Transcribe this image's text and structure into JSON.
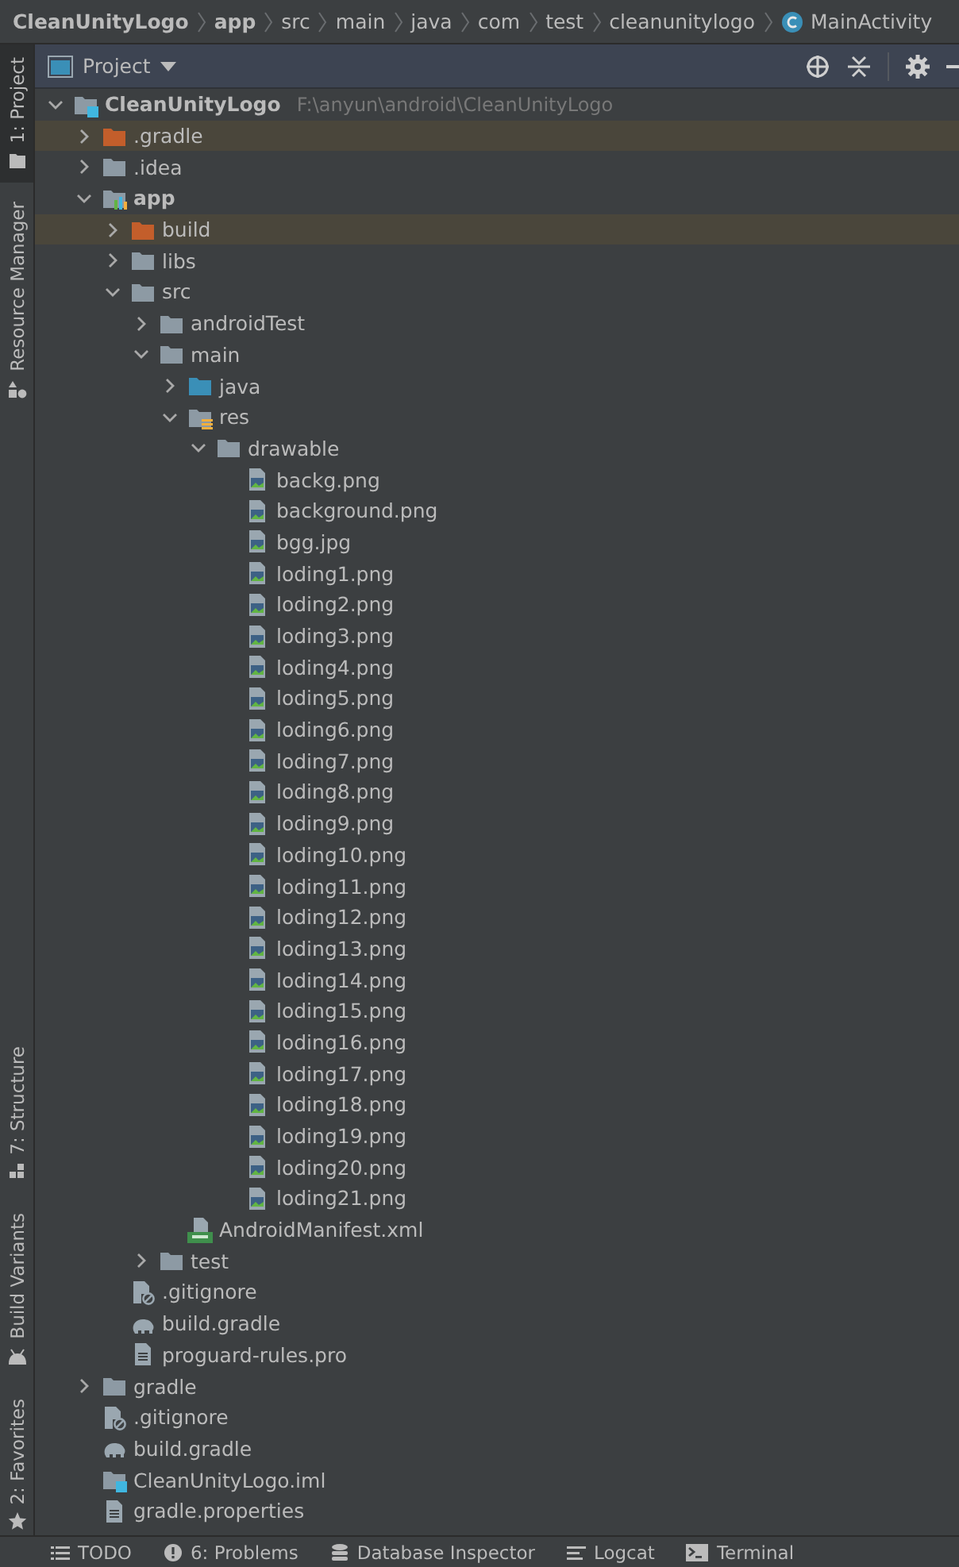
{
  "breadcrumbs": [
    {
      "label": "CleanUnityLogo",
      "kind": "module"
    },
    {
      "label": "app",
      "kind": "module"
    },
    {
      "label": "src",
      "kind": "folder"
    },
    {
      "label": "main",
      "kind": "folder"
    },
    {
      "label": "java",
      "kind": "folder"
    },
    {
      "label": "com",
      "kind": "folder"
    },
    {
      "label": "test",
      "kind": "folder"
    },
    {
      "label": "cleanunitylogo",
      "kind": "folder"
    },
    {
      "label": "MainActivity",
      "kind": "class"
    }
  ],
  "side_tabs": [
    {
      "label": "1: Project",
      "kind": "project",
      "selected": true
    },
    {
      "label": "Resource Manager",
      "kind": "resources",
      "selected": false
    },
    {
      "label": "7: Structure",
      "kind": "structure",
      "selected": false
    },
    {
      "label": "Build Variants",
      "kind": "variants",
      "selected": false
    },
    {
      "label": "2: Favorites",
      "kind": "favorites",
      "selected": false
    }
  ],
  "panel": {
    "title": "Project"
  },
  "tree": [
    {
      "label": "CleanUnityLogo",
      "kind": "project",
      "hint": "F:\\anyun\\android\\CleanUnityLogo",
      "expanded": true,
      "children": [
        {
          "label": ".gradle",
          "kind": "excluded-folder",
          "expanded": false
        },
        {
          "label": ".idea",
          "kind": "folder",
          "expanded": false
        },
        {
          "label": "app",
          "kind": "module",
          "expanded": true,
          "children": [
            {
              "label": "build",
              "kind": "excluded-folder",
              "expanded": false
            },
            {
              "label": "libs",
              "kind": "folder",
              "expanded": false
            },
            {
              "label": "src",
              "kind": "folder",
              "expanded": true,
              "children": [
                {
                  "label": "androidTest",
                  "kind": "folder",
                  "expanded": false
                },
                {
                  "label": "main",
                  "kind": "folder",
                  "expanded": true,
                  "children": [
                    {
                      "label": "java",
                      "kind": "source-folder",
                      "expanded": false
                    },
                    {
                      "label": "res",
                      "kind": "resource-folder",
                      "expanded": true,
                      "children": [
                        {
                          "label": "drawable",
                          "kind": "folder",
                          "expanded": true,
                          "children": [
                            {
                              "label": "backg.png",
                              "kind": "image-file"
                            },
                            {
                              "label": "background.png",
                              "kind": "image-file"
                            },
                            {
                              "label": "bgg.jpg",
                              "kind": "image-file"
                            },
                            {
                              "label": "loding1.png",
                              "kind": "image-file"
                            },
                            {
                              "label": "loding2.png",
                              "kind": "image-file"
                            },
                            {
                              "label": "loding3.png",
                              "kind": "image-file"
                            },
                            {
                              "label": "loding4.png",
                              "kind": "image-file"
                            },
                            {
                              "label": "loding5.png",
                              "kind": "image-file"
                            },
                            {
                              "label": "loding6.png",
                              "kind": "image-file"
                            },
                            {
                              "label": "loding7.png",
                              "kind": "image-file"
                            },
                            {
                              "label": "loding8.png",
                              "kind": "image-file"
                            },
                            {
                              "label": "loding9.png",
                              "kind": "image-file"
                            },
                            {
                              "label": "loding10.png",
                              "kind": "image-file"
                            },
                            {
                              "label": "loding11.png",
                              "kind": "image-file"
                            },
                            {
                              "label": "loding12.png",
                              "kind": "image-file"
                            },
                            {
                              "label": "loding13.png",
                              "kind": "image-file"
                            },
                            {
                              "label": "loding14.png",
                              "kind": "image-file"
                            },
                            {
                              "label": "loding15.png",
                              "kind": "image-file"
                            },
                            {
                              "label": "loding16.png",
                              "kind": "image-file"
                            },
                            {
                              "label": "loding17.png",
                              "kind": "image-file"
                            },
                            {
                              "label": "loding18.png",
                              "kind": "image-file"
                            },
                            {
                              "label": "loding19.png",
                              "kind": "image-file"
                            },
                            {
                              "label": "loding20.png",
                              "kind": "image-file"
                            },
                            {
                              "label": "loding21.png",
                              "kind": "image-file"
                            }
                          ]
                        }
                      ]
                    },
                    {
                      "label": "AndroidManifest.xml",
                      "kind": "manifest-file"
                    }
                  ]
                },
                {
                  "label": "test",
                  "kind": "folder",
                  "expanded": false
                }
              ]
            },
            {
              "label": ".gitignore",
              "kind": "ignore-file"
            },
            {
              "label": "build.gradle",
              "kind": "gradle-file"
            },
            {
              "label": "proguard-rules.pro",
              "kind": "text-file"
            }
          ]
        },
        {
          "label": "gradle",
          "kind": "folder",
          "expanded": false
        },
        {
          "label": ".gitignore",
          "kind": "ignore-file"
        },
        {
          "label": "build.gradle",
          "kind": "gradle-file"
        },
        {
          "label": "CleanUnityLogo.iml",
          "kind": "module-file"
        },
        {
          "label": "gradle.properties",
          "kind": "text-file"
        }
      ]
    }
  ],
  "bottom_tabs": [
    {
      "label": "TODO",
      "kind": "list"
    },
    {
      "label": "6: Problems",
      "kind": "problems"
    },
    {
      "label": "Database Inspector",
      "kind": "database"
    },
    {
      "label": "Logcat",
      "kind": "logcat"
    },
    {
      "label": "Terminal",
      "kind": "terminal"
    }
  ]
}
